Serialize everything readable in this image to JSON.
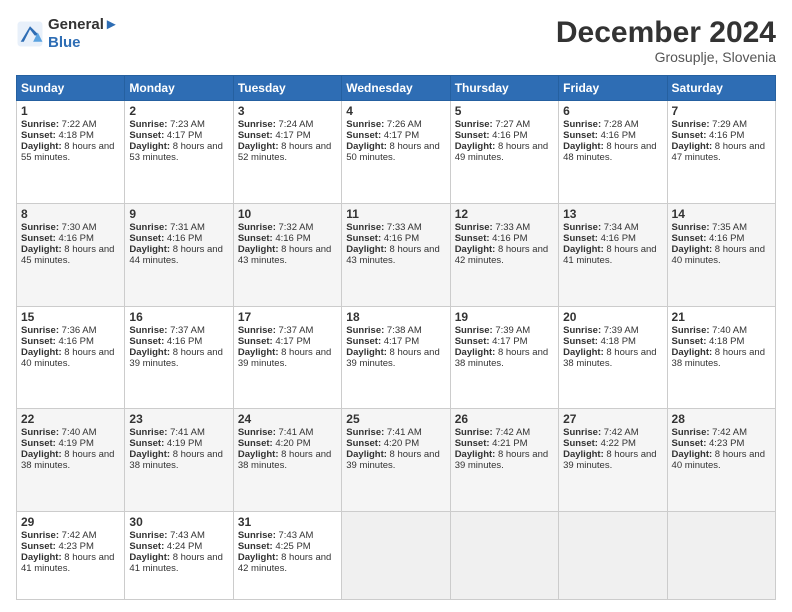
{
  "logo": {
    "line1": "General",
    "line2": "Blue"
  },
  "title": "December 2024",
  "subtitle": "Grosuplje, Slovenia",
  "weekdays": [
    "Sunday",
    "Monday",
    "Tuesday",
    "Wednesday",
    "Thursday",
    "Friday",
    "Saturday"
  ],
  "weeks": [
    [
      {
        "day": "1",
        "rise": "7:22 AM",
        "set": "4:18 PM",
        "daylight": "8 hours and 55 minutes."
      },
      {
        "day": "2",
        "rise": "7:23 AM",
        "set": "4:17 PM",
        "daylight": "8 hours and 53 minutes."
      },
      {
        "day": "3",
        "rise": "7:24 AM",
        "set": "4:17 PM",
        "daylight": "8 hours and 52 minutes."
      },
      {
        "day": "4",
        "rise": "7:26 AM",
        "set": "4:17 PM",
        "daylight": "8 hours and 50 minutes."
      },
      {
        "day": "5",
        "rise": "7:27 AM",
        "set": "4:16 PM",
        "daylight": "8 hours and 49 minutes."
      },
      {
        "day": "6",
        "rise": "7:28 AM",
        "set": "4:16 PM",
        "daylight": "8 hours and 48 minutes."
      },
      {
        "day": "7",
        "rise": "7:29 AM",
        "set": "4:16 PM",
        "daylight": "8 hours and 47 minutes."
      }
    ],
    [
      {
        "day": "8",
        "rise": "7:30 AM",
        "set": "4:16 PM",
        "daylight": "8 hours and 45 minutes."
      },
      {
        "day": "9",
        "rise": "7:31 AM",
        "set": "4:16 PM",
        "daylight": "8 hours and 44 minutes."
      },
      {
        "day": "10",
        "rise": "7:32 AM",
        "set": "4:16 PM",
        "daylight": "8 hours and 43 minutes."
      },
      {
        "day": "11",
        "rise": "7:33 AM",
        "set": "4:16 PM",
        "daylight": "8 hours and 43 minutes."
      },
      {
        "day": "12",
        "rise": "7:33 AM",
        "set": "4:16 PM",
        "daylight": "8 hours and 42 minutes."
      },
      {
        "day": "13",
        "rise": "7:34 AM",
        "set": "4:16 PM",
        "daylight": "8 hours and 41 minutes."
      },
      {
        "day": "14",
        "rise": "7:35 AM",
        "set": "4:16 PM",
        "daylight": "8 hours and 40 minutes."
      }
    ],
    [
      {
        "day": "15",
        "rise": "7:36 AM",
        "set": "4:16 PM",
        "daylight": "8 hours and 40 minutes."
      },
      {
        "day": "16",
        "rise": "7:37 AM",
        "set": "4:16 PM",
        "daylight": "8 hours and 39 minutes."
      },
      {
        "day": "17",
        "rise": "7:37 AM",
        "set": "4:17 PM",
        "daylight": "8 hours and 39 minutes."
      },
      {
        "day": "18",
        "rise": "7:38 AM",
        "set": "4:17 PM",
        "daylight": "8 hours and 39 minutes."
      },
      {
        "day": "19",
        "rise": "7:39 AM",
        "set": "4:17 PM",
        "daylight": "8 hours and 38 minutes."
      },
      {
        "day": "20",
        "rise": "7:39 AM",
        "set": "4:18 PM",
        "daylight": "8 hours and 38 minutes."
      },
      {
        "day": "21",
        "rise": "7:40 AM",
        "set": "4:18 PM",
        "daylight": "8 hours and 38 minutes."
      }
    ],
    [
      {
        "day": "22",
        "rise": "7:40 AM",
        "set": "4:19 PM",
        "daylight": "8 hours and 38 minutes."
      },
      {
        "day": "23",
        "rise": "7:41 AM",
        "set": "4:19 PM",
        "daylight": "8 hours and 38 minutes."
      },
      {
        "day": "24",
        "rise": "7:41 AM",
        "set": "4:20 PM",
        "daylight": "8 hours and 38 minutes."
      },
      {
        "day": "25",
        "rise": "7:41 AM",
        "set": "4:20 PM",
        "daylight": "8 hours and 39 minutes."
      },
      {
        "day": "26",
        "rise": "7:42 AM",
        "set": "4:21 PM",
        "daylight": "8 hours and 39 minutes."
      },
      {
        "day": "27",
        "rise": "7:42 AM",
        "set": "4:22 PM",
        "daylight": "8 hours and 39 minutes."
      },
      {
        "day": "28",
        "rise": "7:42 AM",
        "set": "4:23 PM",
        "daylight": "8 hours and 40 minutes."
      }
    ],
    [
      {
        "day": "29",
        "rise": "7:42 AM",
        "set": "4:23 PM",
        "daylight": "8 hours and 41 minutes."
      },
      {
        "day": "30",
        "rise": "7:43 AM",
        "set": "4:24 PM",
        "daylight": "8 hours and 41 minutes."
      },
      {
        "day": "31",
        "rise": "7:43 AM",
        "set": "4:25 PM",
        "daylight": "8 hours and 42 minutes."
      },
      null,
      null,
      null,
      null
    ]
  ],
  "labels": {
    "sunrise": "Sunrise:",
    "sunset": "Sunset:",
    "daylight": "Daylight:"
  }
}
